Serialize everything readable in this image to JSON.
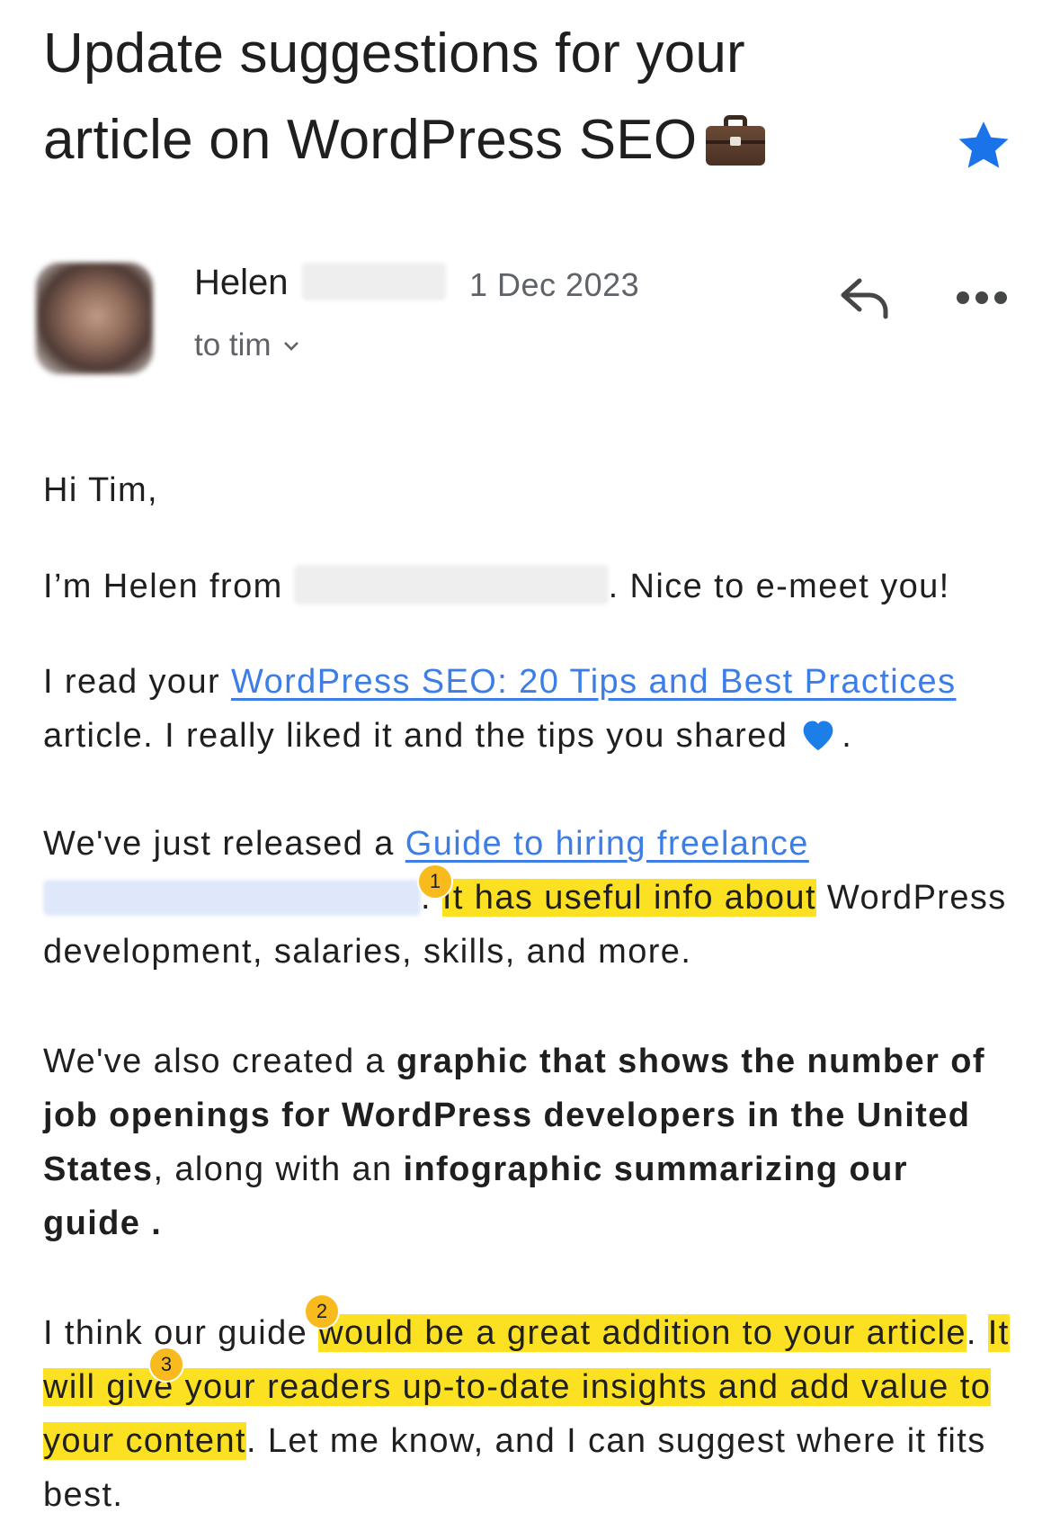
{
  "email": {
    "subject": "Update suggestions for your article on WordPress SEO",
    "subject_emoji": "briefcase",
    "starred": true,
    "sender_first_name": "Helen",
    "date": "1 Dec 2023",
    "recipient": "to tim"
  },
  "body": {
    "greeting": "Hi Tim,",
    "p1_pre": "I’m Helen from ",
    "p1_post": ". Nice to e-meet you!",
    "p2_pre": "I read your ",
    "p2_link": "WordPress SEO: 20 Tips and Best Practices",
    "p2_post": " article. I really liked it and the tips you shared",
    "p2_end": ".",
    "p3_pre": "We've just released a ",
    "p3_link": "Guide to hiring freelance",
    "p3_dot": ". ",
    "p3_highlight": "It has useful info about",
    "p3_post": " WordPress development, salaries, skills, and more.",
    "p4_pre": "We've also created a ",
    "p4_bold1": "graphic that shows the number of job openings for WordPress developers in the United States",
    "p4_mid": ", along with an ",
    "p4_bold2": "infographic summarizing our guide",
    "p4_end": " .",
    "p5_pre": "I think our guide ",
    "p5_hl1": "would be a great addition to your article",
    "p5_dot": ". ",
    "p5_hl2": "It will give your readers up-to-date insights and add value to your content",
    "p5_post": ". Let me know, and I can suggest where it fits best."
  },
  "annotations": [
    "1",
    "2",
    "3"
  ],
  "colors": {
    "highlight": "#fce022",
    "link": "#3c7ee5",
    "star": "#1a73e8",
    "badge": "#f8ba1d"
  }
}
